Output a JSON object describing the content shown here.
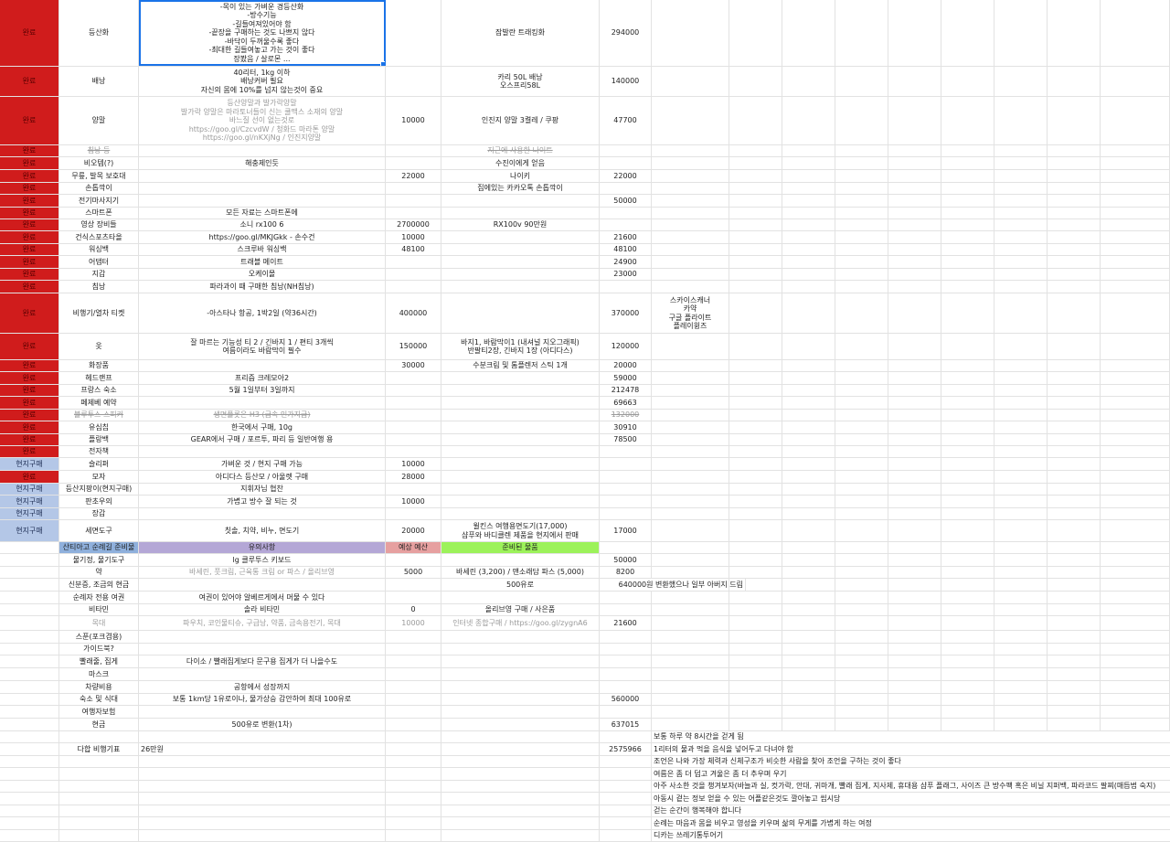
{
  "colors": {
    "red": "#d01c1c",
    "blue": "#b4c7e7",
    "selection": "#1a73e8",
    "header_blue": "#8fb0dc",
    "header_purple": "#b4a7d6",
    "header_pink": "#e6a0a0",
    "header_green": "#9cf25a"
  },
  "rows": [
    {
      "status": "완료",
      "status_color": "red",
      "item": "등산화",
      "note": "-목이 있는 가벼운 경등산화\n-방수기능\n-길들여져있어야 함\n-끝장을 구매하는 것도 나쁘지 않다\n-바닥이 두꺼울수록 좋다\n-최대한 길들여놓고 가는 것이 좋다\n장봤음 / 살로몬 ...",
      "budget": "",
      "bought": "잠발란 트래킹화",
      "price": "294000",
      "extra": ""
    },
    {
      "status": "완료",
      "status_color": "red",
      "item": "배낭",
      "note": "40리터, 1kg 이하\n배낭커버 필요\n자신의 몸에 10%를 넘지 않는것이 중요",
      "budget": "",
      "bought": "카리 50L 배낭\n오스프리58L",
      "price": "140000",
      "extra": ""
    },
    {
      "status": "완료",
      "status_color": "red",
      "item": "양말",
      "note": "등산양말과 발가락양말\n발가락 양말은 마라토너들이 신는 쿨맥스 소재의 양말\n바느질 선이 없는것로\nhttps://goo.gl/CzcvdW / 청화드 마라톤 양말\nhttps://goo.gl/nKXjNg / 인진지양말",
      "budget": "10000",
      "bought": "인진지 양말 3켤레 / 쿠팡",
      "price": "47700",
      "extra": ""
    },
    {
      "status": "완료",
      "status_color": "red",
      "item": "침낭 등",
      "note": "",
      "budget": "",
      "bought": "지근에 사용한 나이트",
      "price": "",
      "extra": ""
    },
    {
      "status": "완료",
      "status_color": "red",
      "item": "비오템(?)",
      "note": "해충제인듯",
      "budget": "",
      "bought": "수진이에게 얻음",
      "price": "",
      "extra": ""
    },
    {
      "status": "완료",
      "status_color": "red",
      "item": "무릎, 발목 보호대",
      "note": "",
      "budget": "22000",
      "bought": "나이키",
      "price": "22000",
      "extra": ""
    },
    {
      "status": "완료",
      "status_color": "red",
      "item": "손톱깍이",
      "note": "",
      "budget": "",
      "bought": "집에있는 카카오톡 손톱깍이",
      "price": "",
      "extra": ""
    },
    {
      "status": "완료",
      "status_color": "red",
      "item": "전기마사지기",
      "note": "",
      "budget": "",
      "bought": "",
      "price": "50000",
      "extra": ""
    },
    {
      "status": "완료",
      "status_color": "red",
      "item": "스마트폰",
      "note": "모든 자료는 스마트폰에",
      "budget": "",
      "bought": "",
      "price": "",
      "extra": ""
    },
    {
      "status": "완료",
      "status_color": "red",
      "item": "영상 장비들",
      "note": "소니 rx100 6",
      "budget": "2700000",
      "bought": "RX100v 90만원",
      "price": "",
      "extra": ""
    },
    {
      "status": "완료",
      "status_color": "red",
      "item": "건식스포츠타올",
      "note": "https://goo.gl/MKJGkk - 손수건",
      "budget": "10000",
      "bought": "",
      "price": "21600",
      "extra": ""
    },
    {
      "status": "완료",
      "status_color": "red",
      "item": "워싱백",
      "note": "스크루바 워싱백",
      "budget": "48100",
      "bought": "",
      "price": "48100",
      "extra": ""
    },
    {
      "status": "완료",
      "status_color": "red",
      "item": "어댑터",
      "note": "트래블 메이트",
      "budget": "",
      "bought": "",
      "price": "24900",
      "extra": ""
    },
    {
      "status": "완료",
      "status_color": "red",
      "item": "지갑",
      "note": "오케이몰",
      "budget": "",
      "bought": "",
      "price": "23000",
      "extra": ""
    },
    {
      "status": "완료",
      "status_color": "red",
      "item": "침낭",
      "note": "파라과이 때 구매한 침낭(NH침낭)",
      "budget": "",
      "bought": "",
      "price": "",
      "extra": ""
    },
    {
      "status": "완료",
      "status_color": "red",
      "item": "비행기/열차 티켓",
      "note": "-아스타나 항공, 1박2일 (약36시간)",
      "budget": "400000",
      "bought": "",
      "price": "370000",
      "extra": "스카이스캐너\n카약\n구글 플라이트\n플레이윙즈"
    },
    {
      "status": "완료",
      "status_color": "red",
      "item": "옷",
      "note": "잘 마르는 기능성 티 2 / 긴바지 1 / 편티 3개씩\n여름이라도 바람막이 필수",
      "budget": "150000",
      "bought": "바지1, 바람막이1 (내셔널 지오그래픽)\n반팔티2장, 긴바지 1장 (아디다스)",
      "price": "120000",
      "extra": ""
    },
    {
      "status": "완료",
      "status_color": "red",
      "item": "화장품",
      "note": "",
      "budget": "30000",
      "bought": "수분크림 및 톰플렌저 스틱 1개",
      "price": "20000",
      "extra": ""
    },
    {
      "status": "완료",
      "status_color": "red",
      "item": "헤드랜프",
      "note": "프리즘 크레모아2",
      "budget": "",
      "bought": "",
      "price": "59000",
      "extra": ""
    },
    {
      "status": "완료",
      "status_color": "red",
      "item": "프랑스 숙소",
      "note": "5월 1일부터 3일까지",
      "budget": "",
      "bought": "",
      "price": "212478",
      "extra": ""
    },
    {
      "status": "완료",
      "status_color": "red",
      "item": "페제베 예약",
      "note": "",
      "budget": "",
      "bought": "",
      "price": "69663",
      "extra": ""
    },
    {
      "status": "완료",
      "status_color": "red",
      "item": "블루투스 스피커",
      "note": "생면플롯은 H3 (금속 인가지금)",
      "budget": "",
      "bought": "",
      "price": "132000",
      "extra": ""
    },
    {
      "status": "완료",
      "status_color": "red",
      "item": "유심칩",
      "note": "한국에서 구매, 10g",
      "budget": "",
      "bought": "",
      "price": "30910",
      "extra": ""
    },
    {
      "status": "완료",
      "status_color": "red",
      "item": "플랑백",
      "note": "GEAR에서 구매 / 포르투, 파리 등 일반여행 용",
      "budget": "",
      "bought": "",
      "price": "78500",
      "extra": ""
    },
    {
      "status": "완료",
      "status_color": "red",
      "item": "전자책",
      "note": "",
      "budget": "",
      "bought": "",
      "price": "",
      "extra": ""
    },
    {
      "status": "현지구매",
      "status_color": "blue",
      "item": "슬리퍼",
      "note": "가벼운 것 / 현지 구매 가능",
      "budget": "10000",
      "bought": "",
      "price": "",
      "extra": ""
    },
    {
      "status": "완료",
      "status_color": "red",
      "item": "모자",
      "note": "아디다스 등산모 / 아울렛 구매",
      "budget": "28000",
      "bought": "",
      "price": "",
      "extra": ""
    },
    {
      "status": "현지구매",
      "status_color": "blue",
      "item": "등산지팡이(현지구매)",
      "note": "지휘자님 협찬",
      "budget": "",
      "bought": "",
      "price": "",
      "extra": ""
    },
    {
      "status": "현지구매",
      "status_color": "blue",
      "item": "판초우의",
      "note": "가볍고 방수 잘 되는 것",
      "budget": "10000",
      "bought": "",
      "price": "",
      "extra": ""
    },
    {
      "status": "현지구매",
      "status_color": "blue",
      "item": "장갑",
      "note": "",
      "budget": "",
      "bought": "",
      "price": "",
      "extra": ""
    },
    {
      "status": "현지구매",
      "status_color": "blue",
      "item": "세면도구",
      "note": "칫솔, 치약, 비누, 면도기",
      "budget": "20000",
      "bought": "윌킨스 여행용면도기(17,000)\n샴푸와 바디클렌 제품을 현지에서 판매",
      "price": "17000",
      "extra": ""
    }
  ],
  "header2": {
    "col1": "산티아고 순례길 준비물",
    "col2": "유의사항",
    "col3": "예상 예산",
    "col4": "준비된 물품"
  },
  "rows2": [
    {
      "item": "물기정, 물기도구",
      "note": "lg 클루투스 키보드",
      "budget": "",
      "bought": "",
      "price": "50000",
      "muted": false
    },
    {
      "item": "약",
      "note": "바세린, 풋크림, 근육통 크림 or 파스 / 올리브영",
      "budget": "5000",
      "bought": "바세린 (3,200) / 맨소래담 파스 (5,000)",
      "price": "8200",
      "muted": false
    },
    {
      "item": "신분증, 조금의 현금",
      "note": "",
      "budget": "",
      "bought": "500유로",
      "price": "640000원 변환했으나 일부 아버지 드림",
      "muted": false
    },
    {
      "item": "순례자 전용 여권",
      "note": "여권이 있어야 알베르게에서 머물 수 있다",
      "budget": "",
      "bought": "",
      "price": "",
      "muted": false
    },
    {
      "item": "비타민",
      "note": "솔라 비타민",
      "budget": "0",
      "bought": "올리브영 구매 / 사은품",
      "price": "",
      "muted": false
    },
    {
      "item": "목대",
      "note": "파우치, 코인물티슈, 구급낭, 약품, 금속용전기, 목대",
      "budget": "10000",
      "bought": "인터넷 종합구매 / https://goo.gl/zygnA6",
      "price": "21600",
      "muted": true
    },
    {
      "item": "스푼(포크겸용)",
      "note": "",
      "budget": "",
      "bought": "",
      "price": "",
      "muted": false
    },
    {
      "item": "가이드북?",
      "note": "",
      "budget": "",
      "bought": "",
      "price": "",
      "muted": false
    },
    {
      "item": "빨래줄, 집게",
      "note": "다이소 / 빨래집게보다 문구용 집게가 더 나을수도",
      "budget": "",
      "bought": "",
      "price": "",
      "muted": false
    },
    {
      "item": "마스크",
      "note": "",
      "budget": "",
      "bought": "",
      "price": "",
      "muted": false
    },
    {
      "item": "차량비용",
      "note": "공항에서 성장까지",
      "budget": "",
      "bought": "",
      "price": "",
      "muted": false
    },
    {
      "item": "숙소 및 식대",
      "note": "보통 1km당 1유로이나, 물가상승 감안하여 최대 100유로",
      "budget": "",
      "bought": "",
      "price": "560000",
      "muted": false
    },
    {
      "item": "여행자보험",
      "note": "",
      "budget": "",
      "bought": "",
      "price": "",
      "muted": false
    },
    {
      "item": "현금",
      "note": "500유로 변환(1차)",
      "budget": "",
      "bought": "",
      "price": "637015",
      "muted": false
    }
  ],
  "total": {
    "label": "다합 비행기표",
    "note": "26만원",
    "price": "2575966"
  },
  "notes": [
    "보통 하루 약 8시간을 걷게 됨",
    "1리터의 물과 먹을 음식을 넣어두고 다녀야 함",
    "조언은 나와 가장 체력과 신체구조가 비슷한 사람을 찾아 조언을 구하는 것이 좋다",
    "여름은 좀 더 덥고 겨울은 좀 더 추우며 우기",
    "아주 사소한 것을 챙겨보자(바늘과 실, 컷가락, 안대, 귀마개, 빨래 집게, 지사제, 휴대용 샴푸 플래그, 사이즈 큰 방수팩 혹은 비닐 지퍼백, 파라코드 팔찌(매듭법 숙지)",
    "아동시 겉는 정보 얻을 수 있는 어플같은것도 깔아놓고 씹시당",
    "걷는 순간이 행복해야 합니다",
    "순례는 마음과 몸을 비우고 영성을 키우며 삶의 무게를 가볍게 하는 여정",
    "디카는 쓰레기통투어기"
  ]
}
